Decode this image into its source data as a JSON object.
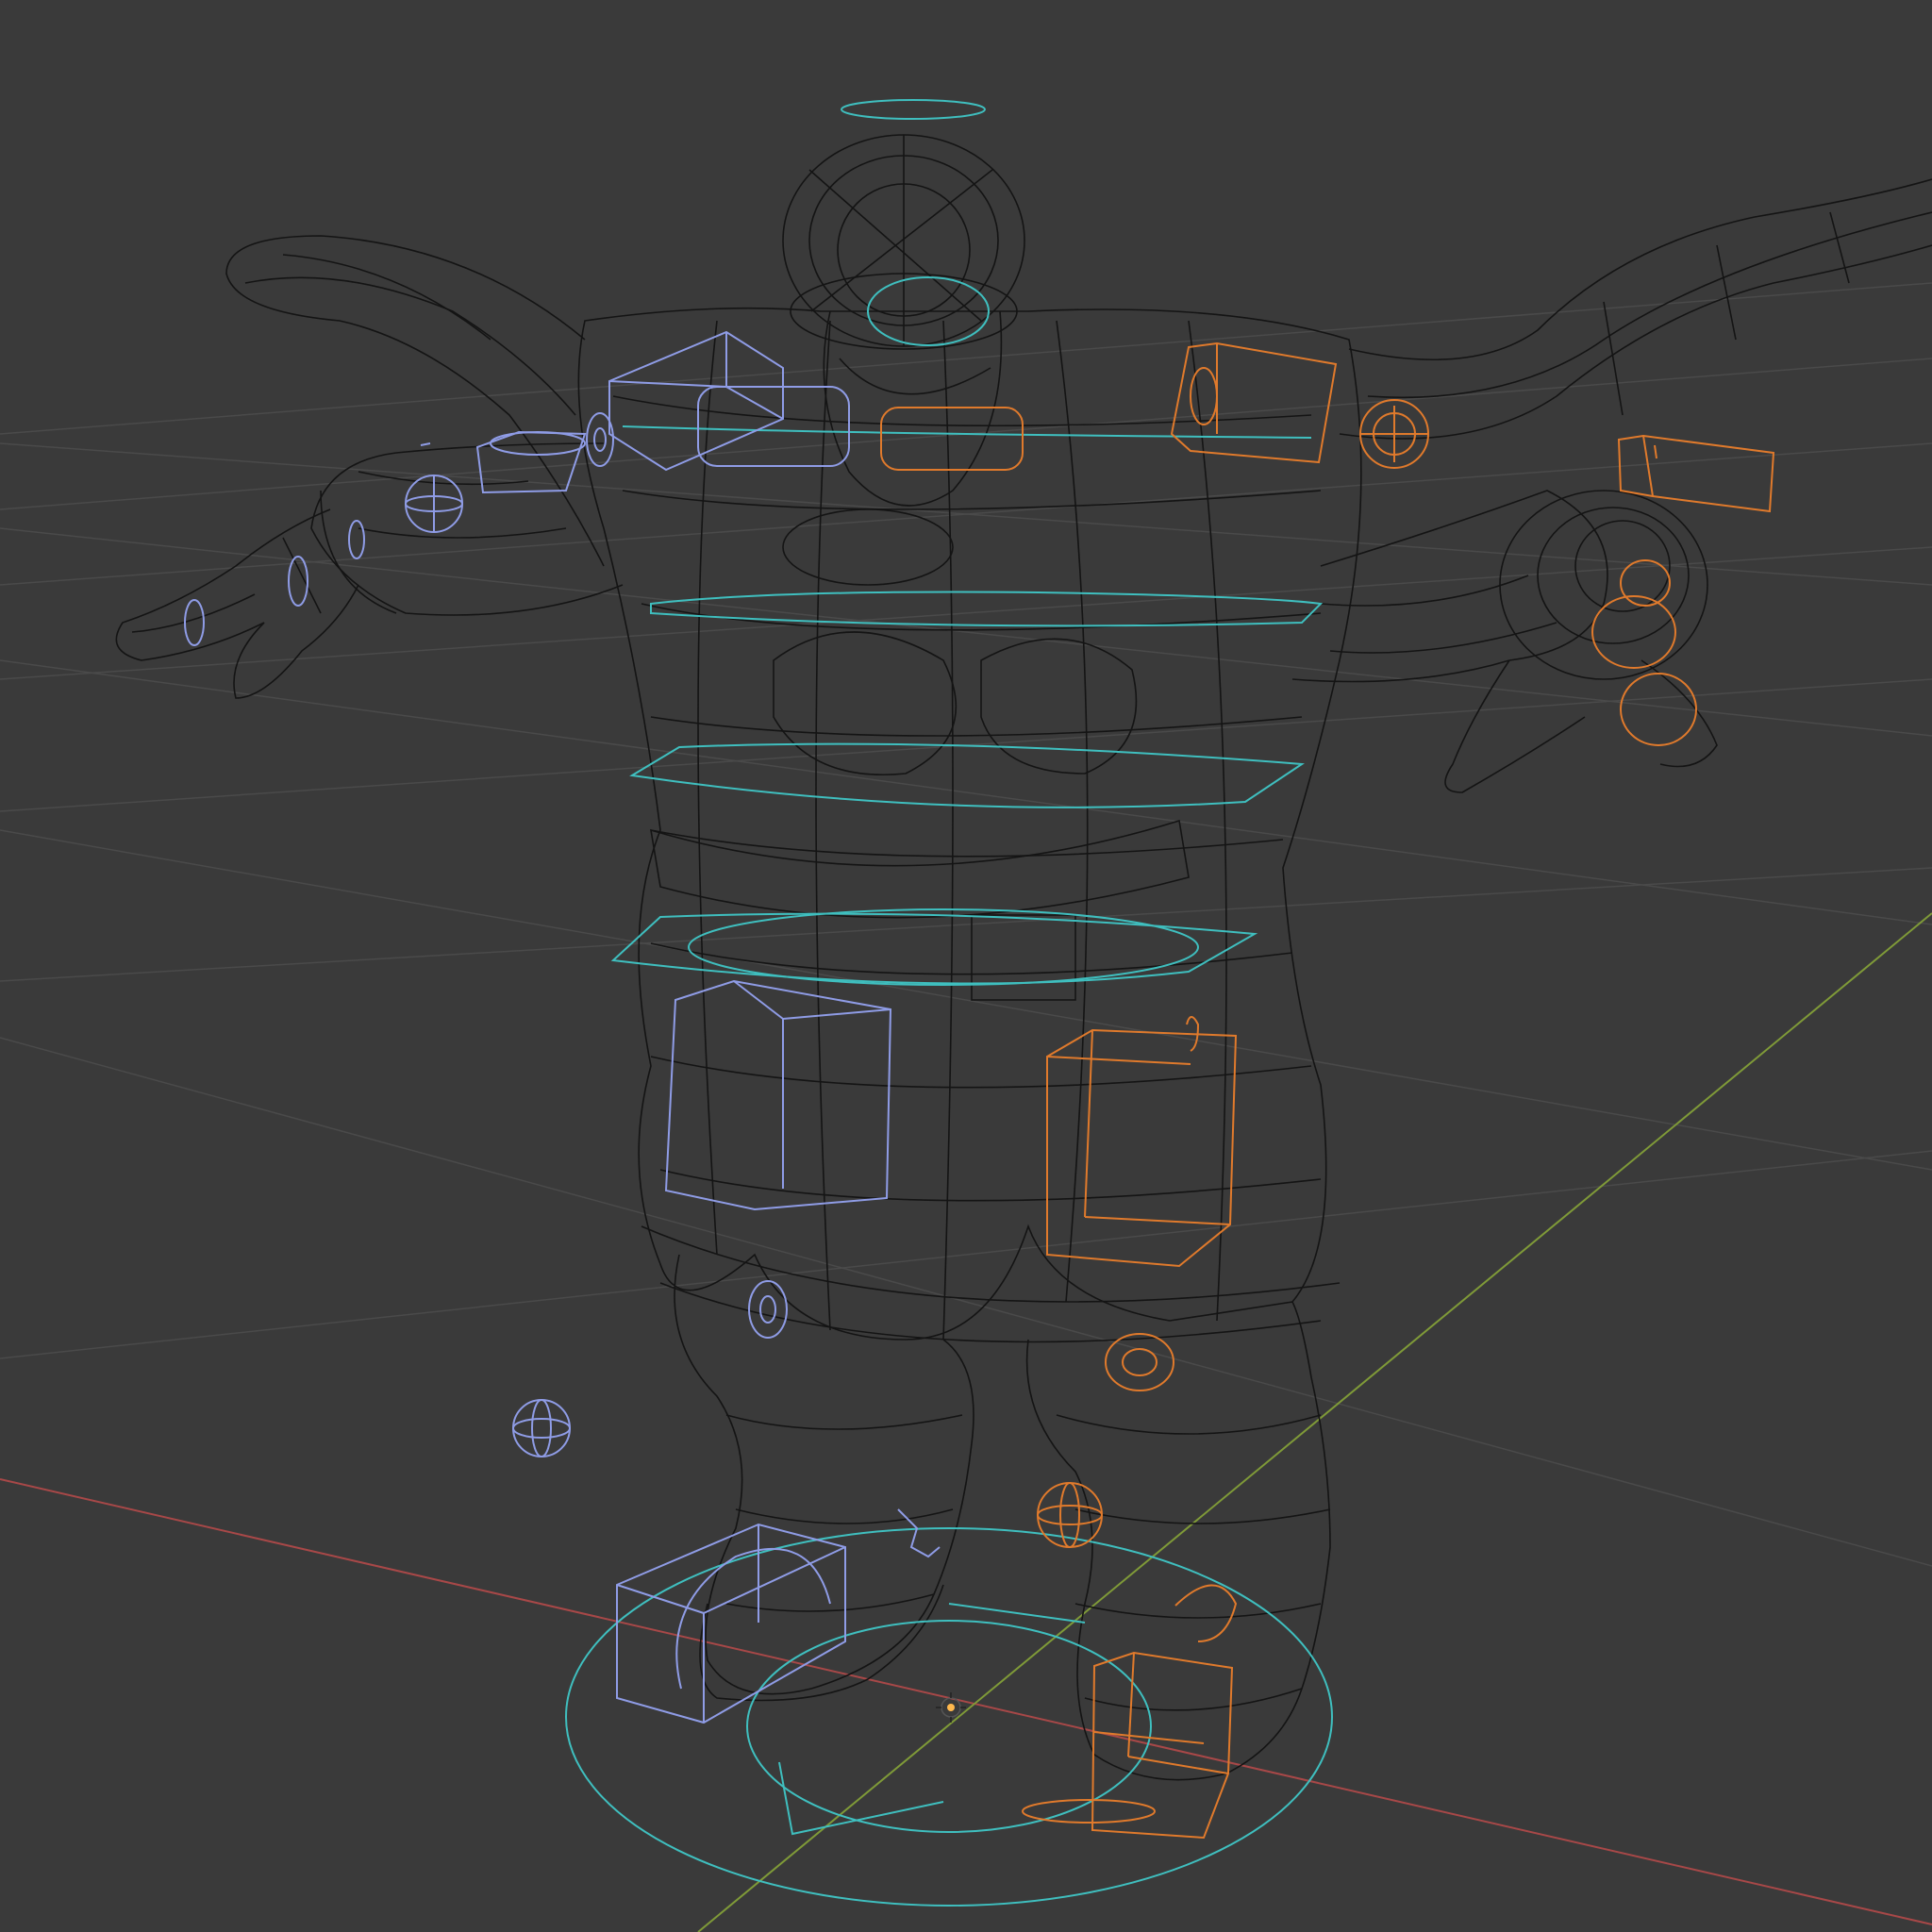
{
  "app": {
    "view": "3d-viewport",
    "shading_mode": "wireframe"
  },
  "colors": {
    "background": "#3a3a3a",
    "grid_line": "#4a4a4a",
    "axis_x": "#a84848",
    "axis_y": "#7f9a38",
    "mesh_wire": "#141414",
    "rig_left": "#8f9ce6",
    "rig_right": "#e07a2c",
    "rig_center": "#3fbfbf",
    "origin_marker": "#ffb84d"
  },
  "icons": {
    "origin": "3d-cursor-icon",
    "ik_pole": "sphere-widget-icon"
  },
  "scene": {
    "armature_controls": {
      "left_side": [
        "hand-ik",
        "upper-arm-fk",
        "shoulder",
        "thigh-fk",
        "knee-pole",
        "foot-ik"
      ],
      "right_side": [
        "shoulder",
        "upper-arm-fk",
        "hand-ik",
        "finger-controls",
        "thigh-fk",
        "knee-pole",
        "foot-ik"
      ],
      "center": [
        "head",
        "neck",
        "chest",
        "spine",
        "hips",
        "root"
      ]
    }
  }
}
